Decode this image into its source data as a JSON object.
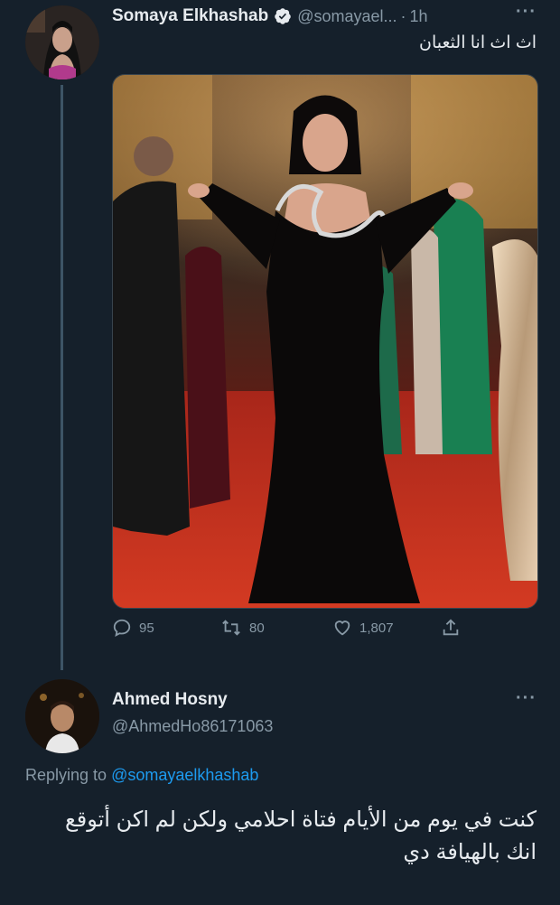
{
  "tweet": {
    "author_name": "Somaya Elkhashab",
    "author_handle": "@somayael...",
    "separator": "·",
    "time": "1h",
    "more_label": "···",
    "text": "اث اث انا الثعبان",
    "media_description_icon": "photo",
    "stats": {
      "replies": "95",
      "retweets": "80",
      "likes": "1,807"
    }
  },
  "reply": {
    "author_name": "Ahmed Hosny",
    "author_handle": "@AhmedHo86171063",
    "more_label": "···",
    "replying_prefix": "Replying to",
    "replying_mention": "@somayaelkhashab",
    "text": "كنت في يوم من الأيام فتاة احلامي ولكن لم اكن أتوقع انك بالهيافة دي"
  },
  "colors": {
    "background": "#15202b",
    "secondary_text": "#8899a6",
    "link": "#1d9bf0",
    "verified_badge": "#e7ebef"
  }
}
